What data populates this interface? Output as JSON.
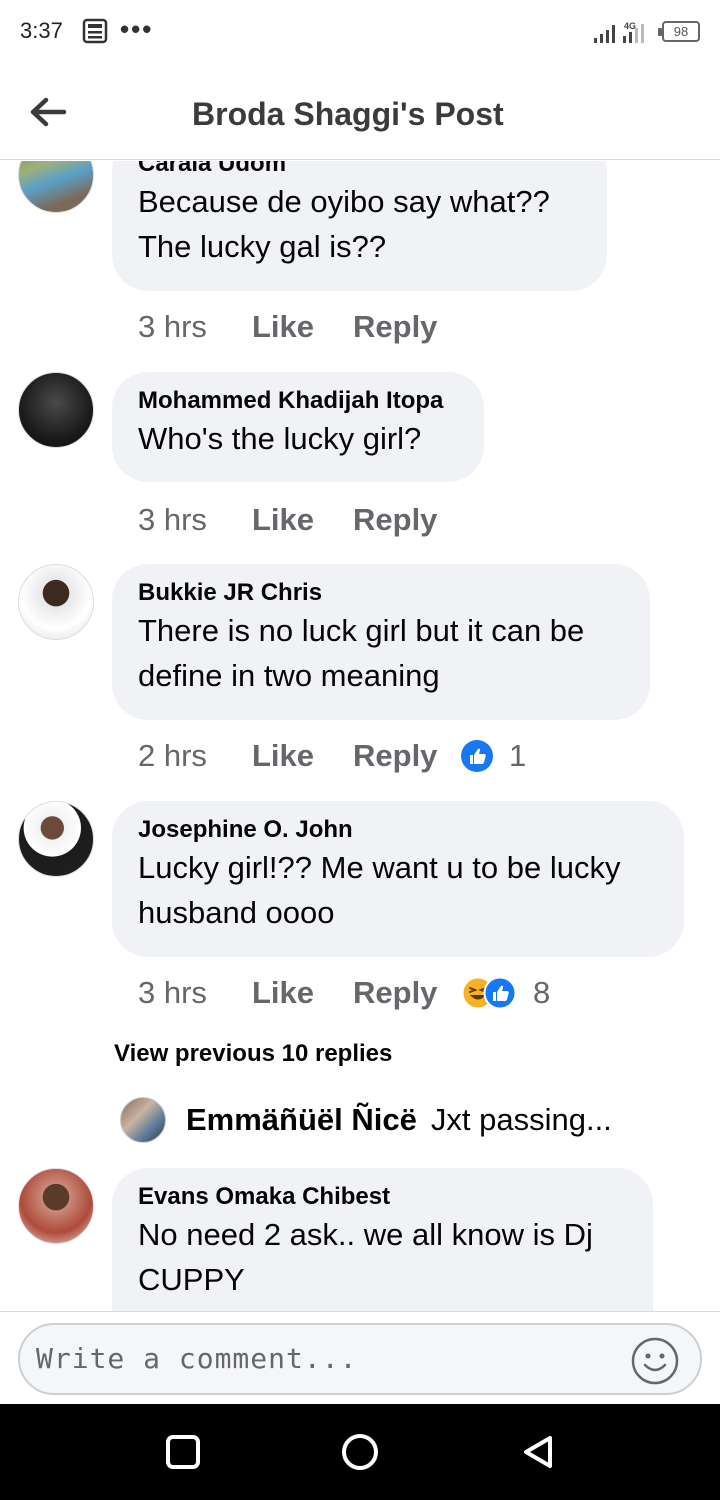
{
  "status_bar": {
    "time": "3:37",
    "network": "4G",
    "battery": "98"
  },
  "header": {
    "title": "Broda Shaggi's Post"
  },
  "comments": [
    {
      "author": "Carala Udom",
      "lines": [
        "Because de oyibo say what??",
        "The lucky gal is??"
      ],
      "time": "3 hrs",
      "like_label": "Like",
      "reply_label": "Reply"
    },
    {
      "author": "Mohammed Khadijah Itopa",
      "lines": [
        "Who's the lucky girl?"
      ],
      "time": "3 hrs",
      "like_label": "Like",
      "reply_label": "Reply"
    },
    {
      "author": "Bukkie JR Chris",
      "lines": [
        "There is no luck girl but it can be",
        "define in two meaning"
      ],
      "time": "2 hrs",
      "like_label": "Like",
      "reply_label": "Reply",
      "reaction_count": "1"
    },
    {
      "author": "Josephine O. John",
      "lines": [
        "Lucky girl!?? Me want u to be lucky",
        "husband oooo"
      ],
      "time": "3 hrs",
      "like_label": "Like",
      "reply_label": "Reply",
      "reaction_count": "8"
    },
    {
      "author": "Evans Omaka Chibest",
      "lines": [
        "No need 2 ask.. we all know is Dj",
        "CUPPY"
      ]
    }
  ],
  "view_previous": "View previous 10 replies",
  "reply_preview": {
    "author": "Emmäñüël Ñicë",
    "text": "Jxt passing..."
  },
  "composer": {
    "placeholder": "Write a comment..."
  },
  "colors": {
    "bubble": "#f0f2f5",
    "like_blue": "#1877f2",
    "meta_gray": "#65676b"
  }
}
